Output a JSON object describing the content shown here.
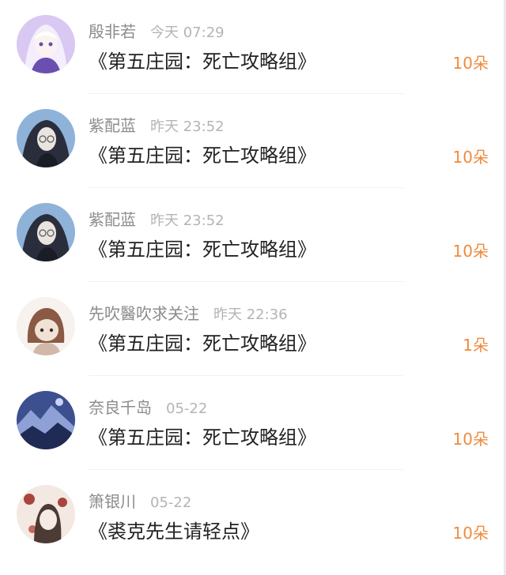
{
  "rows": [
    {
      "user": "殷非若",
      "time": "今天 07:29",
      "book": "《第五庄园：死亡攻略组》",
      "amount": "10朵",
      "avatar_icon": "anime-girl-white-hair-avatar",
      "avatar_colors": [
        "#d9c8f2",
        "#f4eefc",
        "#6a4fb0"
      ]
    },
    {
      "user": "紫配蓝",
      "time": "昨天 23:52",
      "book": "《第五庄园：死亡攻略组》",
      "amount": "10朵",
      "avatar_icon": "anime-man-dark-hair-avatar",
      "avatar_colors": [
        "#8fb2d8",
        "#2a2e3c",
        "#e9e4e0"
      ]
    },
    {
      "user": "紫配蓝",
      "time": "昨天 23:52",
      "book": "《第五庄园：死亡攻略组》",
      "amount": "10朵",
      "avatar_icon": "anime-man-dark-hair-avatar",
      "avatar_colors": [
        "#8fb2d8",
        "#2a2e3c",
        "#e9e4e0"
      ]
    },
    {
      "user": "先吹醫吹求关注",
      "time": "昨天 22:36",
      "book": "《第五庄园：死亡攻略组》",
      "amount": "1朵",
      "avatar_icon": "chibi-hooded-character-avatar",
      "avatar_colors": [
        "#f7f2ee",
        "#8a5a44",
        "#d2b8a8"
      ]
    },
    {
      "user": "奈良千岛",
      "time": "05-22",
      "book": "《第五庄园：死亡攻略组》",
      "amount": "10朵",
      "avatar_icon": "blue-landscape-avatar",
      "avatar_colors": [
        "#3c4f8e",
        "#8ea0d6",
        "#1f2a55"
      ]
    },
    {
      "user": "箫银川",
      "time": "05-22",
      "book": "《裘克先生请轻点》",
      "amount": "10朵",
      "avatar_icon": "anime-floral-character-avatar",
      "avatar_colors": [
        "#f3e8e2",
        "#a8453c",
        "#4c3a34"
      ]
    }
  ]
}
